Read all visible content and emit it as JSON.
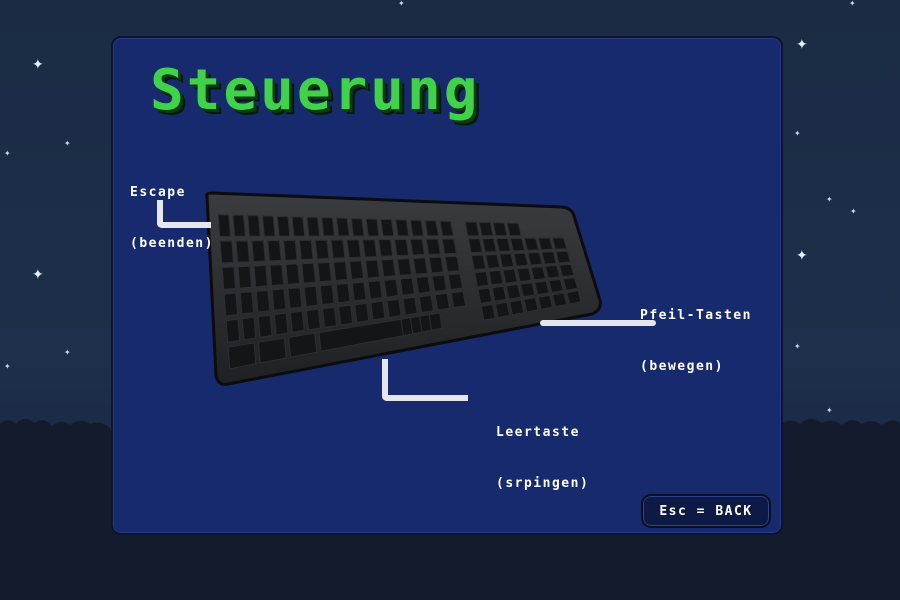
{
  "screen": {
    "title": "Steuerung",
    "controls": [
      {
        "key": "Escape",
        "action": "(beenden)"
      },
      {
        "key": "Pfeil-Tasten",
        "action": "(bewegen)"
      },
      {
        "key": "Leertaste",
        "action": "(srpingen)"
      }
    ],
    "back_button": "Esc = BACK"
  },
  "colors": {
    "background": "#1b2b44",
    "panel": "#182a6e",
    "title": "#3fd24a",
    "text": "#ffffff"
  }
}
